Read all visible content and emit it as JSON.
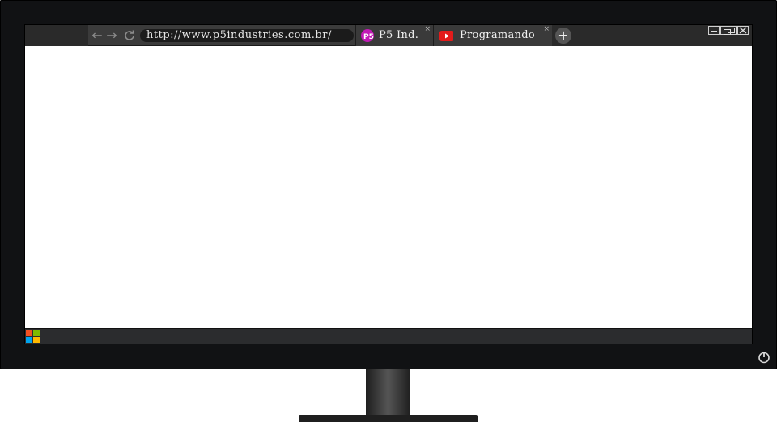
{
  "browser": {
    "address_bar": {
      "url": "http://www.p5industries.com.br/"
    },
    "nav": {
      "back_icon": "back-arrow-icon",
      "forward_icon": "forward-arrow-icon",
      "reload_icon": "reload-icon"
    },
    "tabs": [
      {
        "label": "P5 Ind.",
        "icon": "p5-logo-icon",
        "close": "×",
        "icon_color": "#c21ab6"
      },
      {
        "label": "Programando",
        "icon": "youtube-icon",
        "close": "×",
        "icon_color": "#e31b1b"
      }
    ],
    "new_tab_label": "+",
    "window_controls": [
      "minimize-icon",
      "restore-icon",
      "close-icon"
    ]
  },
  "taskbar": {
    "start_icon": "windows-start-icon",
    "start_colors": [
      "#f25022",
      "#7fba00",
      "#00a4ef",
      "#ffb900"
    ]
  },
  "monitor": {
    "power_icon": "power-icon",
    "bezel_color": "#111214"
  }
}
